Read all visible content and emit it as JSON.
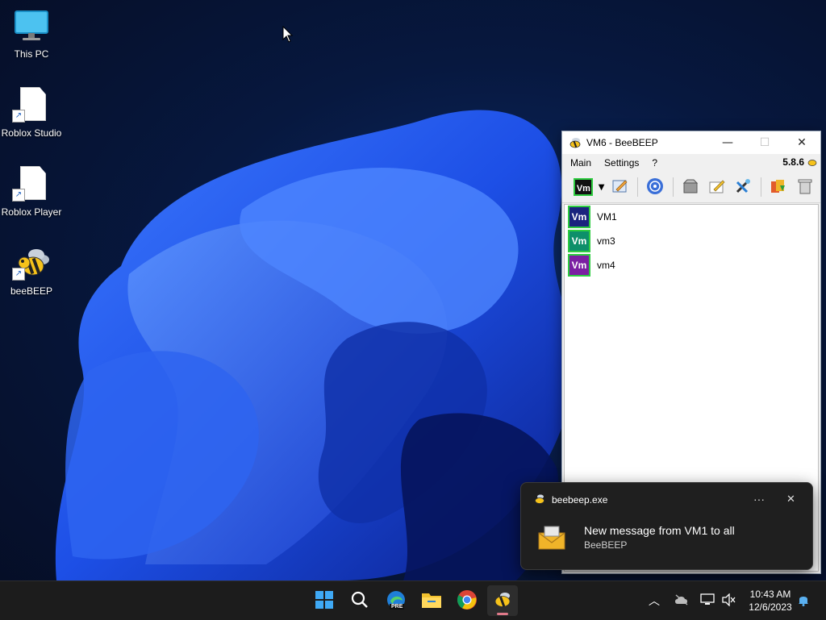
{
  "desktop": {
    "icons": [
      {
        "label": "This PC",
        "icon": "monitor-icon"
      },
      {
        "label": "Roblox Studio",
        "icon": "document-shortcut-icon"
      },
      {
        "label": "Roblox Player",
        "icon": "document-shortcut-icon"
      },
      {
        "label": "beeBEEP",
        "icon": "bee-icon"
      }
    ]
  },
  "window": {
    "title": "VM6 - BeeBEEP",
    "version": "5.8.6",
    "menu": [
      "Main",
      "Settings",
      "?"
    ],
    "toolbar_status_badge": "Vm",
    "users": [
      {
        "badge": "Vm",
        "name": "VM1",
        "color": "#1a237e"
      },
      {
        "badge": "Vm",
        "name": "vm3",
        "color": "#0d8f6a"
      },
      {
        "badge": "Vm",
        "name": "vm4",
        "color": "#7b1fa2"
      }
    ]
  },
  "notification": {
    "app": "beebeep.exe",
    "message": "New message from VM1 to all",
    "source": "BeeBEEP",
    "more_label": "···",
    "close_label": "✕"
  },
  "taskbar": {
    "apps": [
      "start-icon",
      "search-icon",
      "edge-preview-icon",
      "file-explorer-icon",
      "chrome-icon",
      "beebeep-icon"
    ],
    "edge_badge": "PRE",
    "clock": {
      "time": "10:43 AM",
      "date": "12/6/2023"
    }
  }
}
